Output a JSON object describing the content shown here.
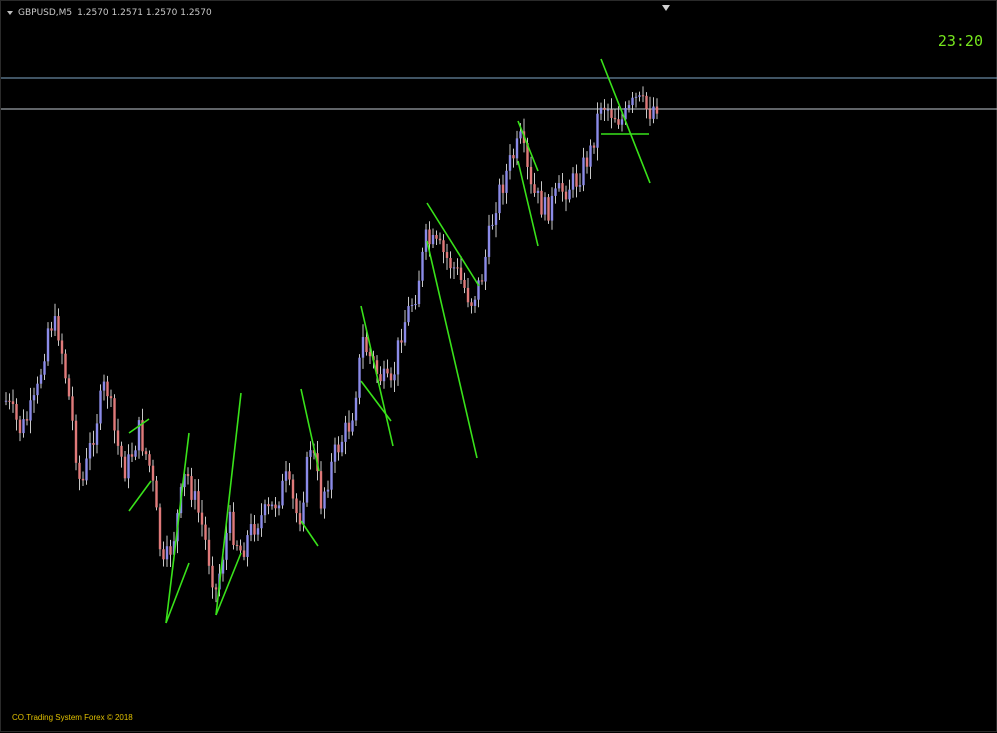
{
  "header": {
    "symbol": "GBPUSD,M5",
    "ohlc": "1.2570 1.2571 1.2570 1.2570"
  },
  "clock": "23:20",
  "footer": "CO.Trading System Forex  ©  2018",
  "colors": {
    "background": "#000000",
    "bull_candle": "#8b8be8",
    "bear_candle": "#e07a7a",
    "indicator": "#39e21a",
    "level_line": "#7fa7c8",
    "clock_text": "#76e61d",
    "footer_text": "#e0c000"
  },
  "icons": {
    "menu": "dropdown-triangle-icon",
    "shift": "chart-shift-triangle-icon"
  }
}
